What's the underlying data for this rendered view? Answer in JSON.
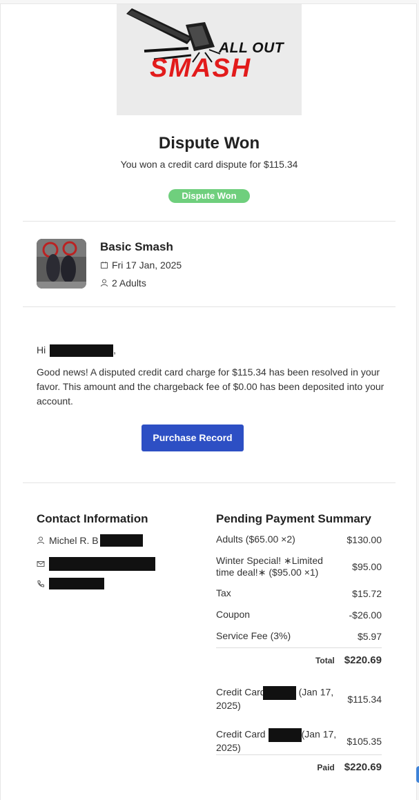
{
  "brand": {
    "line1": "ALL OUT",
    "line2": "SMASH"
  },
  "header": {
    "title": "Dispute Won",
    "subtitle": "You won a credit card dispute for $115.34",
    "badge": "Dispute Won"
  },
  "booking": {
    "name": "Basic Smash",
    "date": "Fri 17 Jan, 2025",
    "guests": "2 Adults"
  },
  "message": {
    "greeting": "Hi",
    "greeting_suffix": ",",
    "body": "Good news! A disputed credit card charge for $115.34 has been resolved in your favor. This amount and the chargeback fee of $0.00 has been deposited into your account.",
    "button": "Purchase Record"
  },
  "contact": {
    "title": "Contact Information",
    "name": "Michel R. B"
  },
  "payment": {
    "title": "Pending Payment Summary",
    "items": [
      {
        "label": "Adults ($65.00 ×2)",
        "amount": "$130.00"
      },
      {
        "label": "Winter Special! ∗Limited time deal!∗ ($95.00 ×1)",
        "amount": "$95.00"
      },
      {
        "label": "Tax",
        "amount": "$15.72"
      },
      {
        "label": "Coupon",
        "amount": "-$26.00"
      },
      {
        "label": "Service Fee (3%)",
        "amount": "$5.97"
      }
    ],
    "total_label": "Total",
    "total_value": "$220.69",
    "charges": [
      {
        "label_a": "Credit Card",
        "label_b": "(Jan 17, 2025)",
        "amount": "$115.34"
      },
      {
        "label_a": "Credit Card",
        "label_b": "(Jan 17, 2025)",
        "amount": "$105.35"
      }
    ],
    "paid_label": "Paid",
    "paid_value": "$220.69"
  },
  "colors": {
    "badge": "#6fcf7d",
    "button": "#2d4fc4",
    "brand_red": "#e21b1b"
  }
}
